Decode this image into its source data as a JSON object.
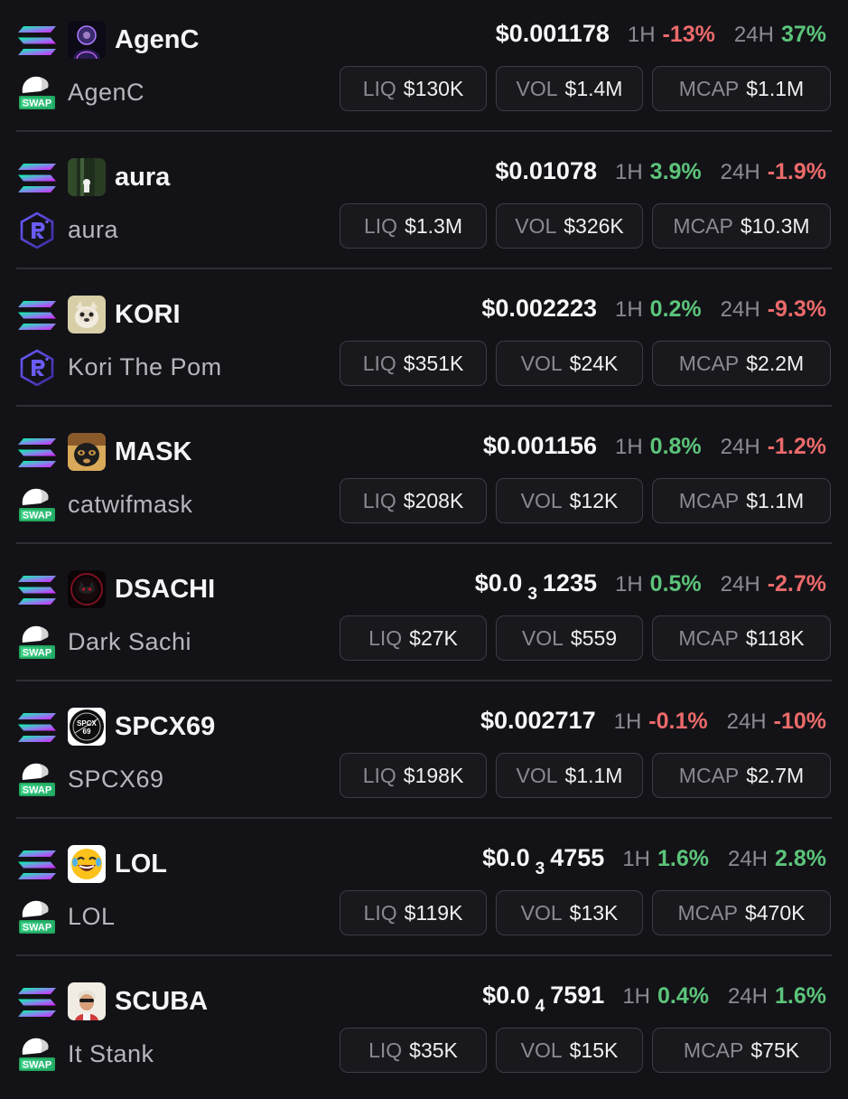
{
  "colors": {
    "background": "#131317",
    "positive": "#5cc47a",
    "negative": "#ec6a6a",
    "muted": "#8a8a92",
    "pill_border": "#3c3c44"
  },
  "labels": {
    "h1": "1H",
    "h24": "24H",
    "liq": "LIQ",
    "vol": "VOL",
    "mcap": "MCAP",
    "swap_badge": "SWAP"
  },
  "tokens": [
    {
      "chain_icon": "solana-icon",
      "avatar_icon": "agenc-avatar-icon",
      "symbol": "AgenC",
      "dex_icon": "swap-icon",
      "name": "AgenC",
      "price": {
        "main": "$0.001178",
        "zeros": "",
        "tail": ""
      },
      "change_1h": "-13%",
      "change_1h_dir": "neg",
      "change_24h": "37%",
      "change_24h_dir": "pos",
      "liq": "$130K",
      "vol": "$1.4M",
      "mcap": "$1.1M"
    },
    {
      "chain_icon": "solana-icon",
      "avatar_icon": "aura-avatar-icon",
      "symbol": "aura",
      "dex_icon": "raydium-icon",
      "name": "aura",
      "price": {
        "main": "$0.01078",
        "zeros": "",
        "tail": ""
      },
      "change_1h": "3.9%",
      "change_1h_dir": "pos",
      "change_24h": "-1.9%",
      "change_24h_dir": "neg",
      "liq": "$1.3M",
      "vol": "$326K",
      "mcap": "$10.3M"
    },
    {
      "chain_icon": "solana-icon",
      "avatar_icon": "kori-avatar-icon",
      "symbol": "KORI",
      "dex_icon": "raydium-icon",
      "name": "Kori The Pom",
      "price": {
        "main": "$0.002223",
        "zeros": "",
        "tail": ""
      },
      "change_1h": "0.2%",
      "change_1h_dir": "pos",
      "change_24h": "-9.3%",
      "change_24h_dir": "neg",
      "liq": "$351K",
      "vol": "$24K",
      "mcap": "$2.2M"
    },
    {
      "chain_icon": "solana-icon",
      "avatar_icon": "mask-avatar-icon",
      "symbol": "MASK",
      "dex_icon": "swap-icon",
      "name": "catwifmask",
      "price": {
        "main": "$0.001156",
        "zeros": "",
        "tail": ""
      },
      "change_1h": "0.8%",
      "change_1h_dir": "pos",
      "change_24h": "-1.2%",
      "change_24h_dir": "neg",
      "liq": "$208K",
      "vol": "$12K",
      "mcap": "$1.1M"
    },
    {
      "chain_icon": "solana-icon",
      "avatar_icon": "dsachi-avatar-icon",
      "symbol": "DSACHI",
      "dex_icon": "swap-icon",
      "name": "Dark Sachi",
      "price": {
        "main": "$0.0",
        "zeros": "3",
        "tail": "1235"
      },
      "change_1h": "0.5%",
      "change_1h_dir": "pos",
      "change_24h": "-2.7%",
      "change_24h_dir": "neg",
      "liq": "$27K",
      "vol": "$559",
      "mcap": "$118K"
    },
    {
      "chain_icon": "solana-icon",
      "avatar_icon": "spcx69-avatar-icon",
      "symbol": "SPCX69",
      "dex_icon": "swap-icon",
      "name": "SPCX69",
      "price": {
        "main": "$0.002717",
        "zeros": "",
        "tail": ""
      },
      "change_1h": "-0.1%",
      "change_1h_dir": "neg",
      "change_24h": "-10%",
      "change_24h_dir": "neg",
      "liq": "$198K",
      "vol": "$1.1M",
      "mcap": "$2.7M"
    },
    {
      "chain_icon": "solana-icon",
      "avatar_icon": "laughing-emoji-icon",
      "symbol": "LOL",
      "dex_icon": "swap-icon",
      "name": "LOL",
      "price": {
        "main": "$0.0",
        "zeros": "3",
        "tail": "4755"
      },
      "change_1h": "1.6%",
      "change_1h_dir": "pos",
      "change_24h": "2.8%",
      "change_24h_dir": "pos",
      "liq": "$119K",
      "vol": "$13K",
      "mcap": "$470K"
    },
    {
      "chain_icon": "solana-icon",
      "avatar_icon": "scuba-avatar-icon",
      "symbol": "SCUBA",
      "dex_icon": "swap-icon",
      "name": "It Stank",
      "price": {
        "main": "$0.0",
        "zeros": "4",
        "tail": "7591"
      },
      "change_1h": "0.4%",
      "change_1h_dir": "pos",
      "change_24h": "1.6%",
      "change_24h_dir": "pos",
      "liq": "$35K",
      "vol": "$15K",
      "mcap": "$75K"
    }
  ]
}
